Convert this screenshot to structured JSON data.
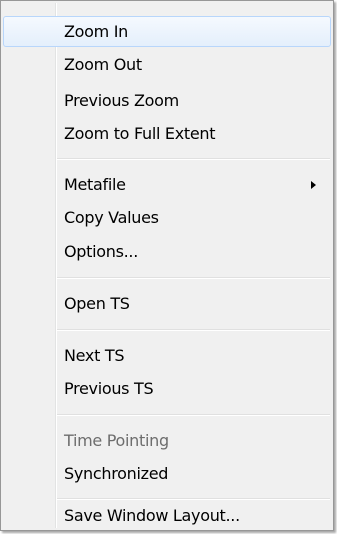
{
  "menu": {
    "items": [
      {
        "label": "Zoom In"
      },
      {
        "label": "Zoom Out"
      },
      {
        "label": "Previous Zoom"
      },
      {
        "label": "Zoom to Full Extent"
      },
      {
        "label": "Metafile"
      },
      {
        "label": "Copy Values"
      },
      {
        "label": "Options..."
      },
      {
        "label": "Open TS"
      },
      {
        "label": "Next TS"
      },
      {
        "label": "Previous TS"
      },
      {
        "label": "Time Pointing"
      },
      {
        "label": "Synchronized"
      },
      {
        "label": "Save Window Layout..."
      }
    ],
    "submenu_icon": "chevron-right-icon",
    "disabled_color": "#6d6d6d",
    "hover_color": "#b8d6fb"
  }
}
